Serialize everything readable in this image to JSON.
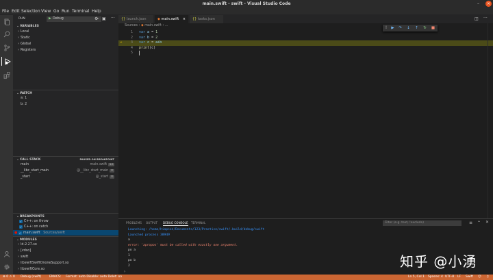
{
  "window": {
    "title": "main.swift - swift - Visual Studio Code"
  },
  "menu": [
    "File",
    "Edit",
    "Selection",
    "View",
    "Go",
    "Run",
    "Terminal",
    "Help"
  ],
  "run_panel": {
    "label": "RUN",
    "config": "Debug",
    "variables": {
      "header": "VARIABLES",
      "scopes": [
        "Local",
        "Static",
        "Global",
        "Registers"
      ]
    },
    "watch": {
      "header": "WATCH",
      "items": [
        "a: 1",
        "b: 2"
      ]
    },
    "call_stack": {
      "header": "CALL STACK",
      "status": "PAUSED ON BREAKPOINT",
      "frames": [
        {
          "name": "main",
          "file": "main.swift",
          "line": "3:9"
        },
        {
          "name": "__libc_start_main",
          "file": "@__libc_start_main",
          "line": "??"
        },
        {
          "name": "_start",
          "file": "@_start",
          "line": "??"
        }
      ]
    },
    "breakpoints": {
      "header": "BREAKPOINTS",
      "items": [
        {
          "label": "C++: on throw"
        },
        {
          "label": "C++: on catch"
        },
        {
          "label": "main.swift",
          "detail": "Sources/swift"
        }
      ]
    },
    "modules": {
      "header": "MODULES",
      "items": [
        "ld-2.27.so",
        "[vdso]",
        "swift",
        "libswiftSwiftOnoneSupport.so",
        "libswiftCore.so"
      ]
    }
  },
  "editor": {
    "tabs": [
      "launch.json",
      "main.swift",
      "tasks.json"
    ],
    "breadcrumb": [
      "Sources",
      "main.swift",
      "..."
    ],
    "lines": [
      {
        "n": "1",
        "kw": "var",
        "var": "a",
        "op": " = ",
        "val": "1"
      },
      {
        "n": "2",
        "kw": "var",
        "var": "b",
        "op": " = ",
        "val": "2"
      },
      {
        "n": "3",
        "kw": "var",
        "var": "c",
        "op": " = ",
        "val": "a+b"
      },
      {
        "n": "4",
        "fn": "print",
        "rest": "(c)"
      },
      {
        "n": "5"
      }
    ]
  },
  "panel": {
    "tabs": [
      "PROBLEMS",
      "OUTPUT",
      "DEBUG CONSOLE",
      "TERMINAL"
    ],
    "filter_placeholder": "Filter (e.g. text, !exclude)",
    "lines": [
      {
        "text": "Launching: /home/hiapson/Documents/123/Practice/swift/.build/debug/swift",
        "color": "#3794ff"
      },
      {
        "text": "Launched process 38949",
        "color": "#3794ff"
      },
      {
        "text": "a",
        "color": "#cccccc"
      },
      {
        "text": "error: 'apropos' must be called with exactly one argument.",
        "color": "#f48771"
      },
      {
        "text": "po a",
        "color": "#cccccc"
      },
      {
        "text": "1",
        "color": "#cccccc"
      },
      {
        "text": "po b",
        "color": "#cccccc"
      },
      {
        "text": "2",
        "color": "#cccccc"
      }
    ]
  },
  "status_bar": {
    "left": [
      "⊗ 0 ⚠ 0",
      "Debug (swift)",
      "EMACS:",
      "Format: auto  Disable: auto  Delet: on"
    ],
    "right": [
      "Ln 5, Col 1",
      "Spaces: 4",
      "UTF-8",
      "LF",
      "Swift"
    ]
  },
  "watermark": "知乎 @小湧",
  "colors": {
    "status_bar": "#cc6633",
    "current_line": "#4b4b18",
    "accent": "#0e639c"
  }
}
